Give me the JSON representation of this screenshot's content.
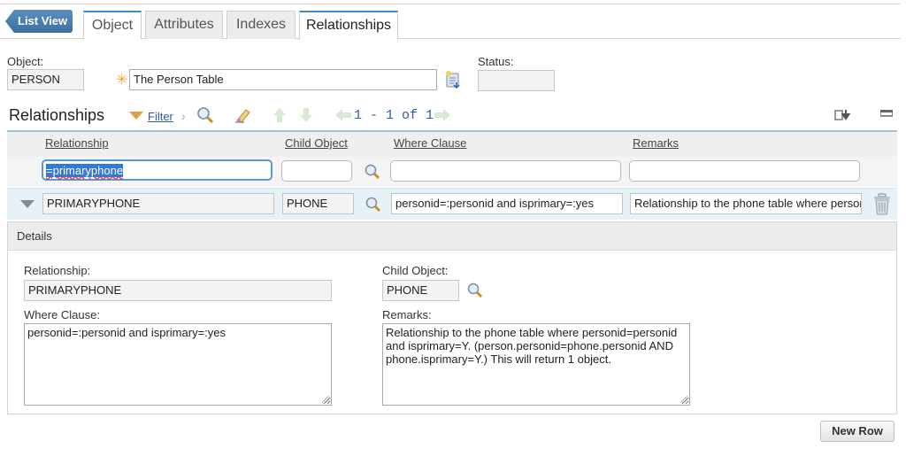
{
  "nav": {
    "list_view": "List View",
    "tabs": [
      {
        "label": "Object",
        "active": false
      },
      {
        "label": "Attributes",
        "active": false
      },
      {
        "label": "Indexes",
        "active": false
      },
      {
        "label": "Relationships",
        "active": true
      }
    ]
  },
  "header": {
    "object_label": "Object:",
    "object_value": "PERSON",
    "description_value": "The Person Table",
    "status_label": "Status:",
    "status_value": ""
  },
  "relationships": {
    "title": "Relationships",
    "filter_label": "Filter",
    "pager": "1 - 1 of 1",
    "columns": [
      "Relationship",
      "Child Object",
      "Where Clause",
      "Remarks"
    ],
    "filter_values": {
      "relationship": "=primaryphone",
      "child_object": "",
      "where_clause": "",
      "remarks": ""
    },
    "rows": [
      {
        "relationship": "PRIMARYPHONE",
        "child_object": "PHONE",
        "where_clause": "personid=:personid and  isprimary=:yes",
        "remarks": "Relationship to the phone table where personid=personid and isprimary=Y.  (person.personid=phone.personid AND phone.isprimary=Y.)  This will return 1 object."
      }
    ]
  },
  "details": {
    "title": "Details",
    "relationship_label": "Relationship:",
    "relationship_value": "PRIMARYPHONE",
    "child_object_label": "Child Object:",
    "child_object_value": "PHONE",
    "where_clause_label": "Where Clause:",
    "where_clause_value": "personid=:personid and  isprimary=:yes",
    "remarks_label": "Remarks:",
    "remarks_value": "Relationship to the phone table where personid=personid and isprimary=Y.  (person.personid=phone.personid AND phone.isprimary=Y.)  This will return 1 object."
  },
  "footer": {
    "new_row_label": "New Row"
  },
  "colors": {
    "accent": "#3d8ec9",
    "list_view_bg": "#4a7fb0",
    "selected_row_bg": "#e6f1f8",
    "link": "#2a5aa8",
    "required_star": "#f0a030"
  }
}
